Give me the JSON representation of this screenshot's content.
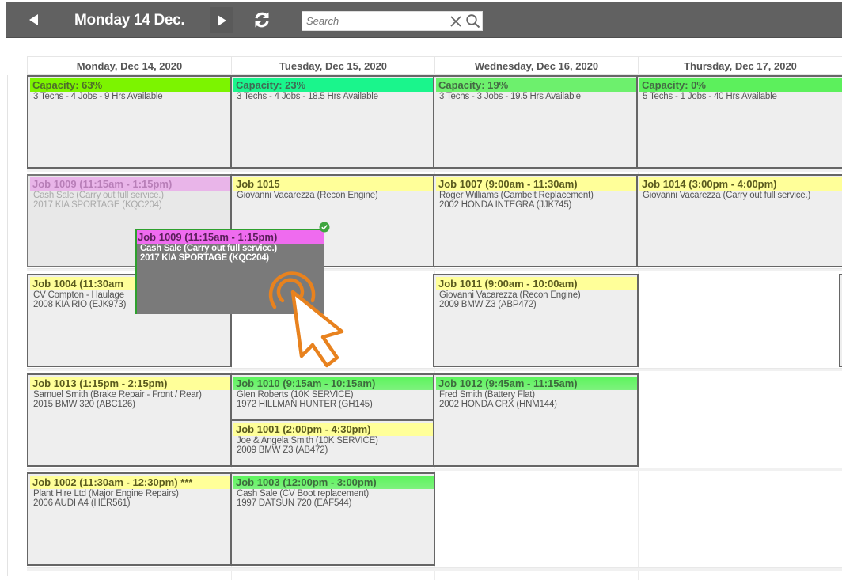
{
  "toolbar": {
    "prev_icon": "triangle-left-icon",
    "title": "Monday 14 Dec.",
    "next_icon": "triangle-right-icon",
    "refresh_icon": "refresh-icon",
    "search": {
      "placeholder": "Search",
      "value": "",
      "clear_icon": "close-icon",
      "search_icon": "search-icon"
    }
  },
  "calendar": {
    "days": [
      {
        "label": "Monday, Dec 14, 2020"
      },
      {
        "label": "Tuesday, Dec 15, 2020"
      },
      {
        "label": "Wednesday, Dec 16, 2020"
      },
      {
        "label": "Thursday, Dec 17, 2020"
      }
    ],
    "capacity": [
      {
        "title": "Capacity: 63%",
        "percent": 63,
        "summary": "3 Techs - 4 Jobs - 9 Hrs Available",
        "color": "#7cf400"
      },
      {
        "title": "Capacity: 23%",
        "percent": 23,
        "summary": "3 Techs - 4 Jobs - 18.5 Hrs Available",
        "color": "#1af58c"
      },
      {
        "title": "Capacity: 19%",
        "percent": 19,
        "summary": "3 Techs - 3 Jobs - 19.5 Hrs Available",
        "color": "#6df06d"
      },
      {
        "title": "Capacity: 0%",
        "percent": 0,
        "summary": "5 Techs - 1 Jobs - 40 Hrs Available",
        "color": "#5cf05c"
      }
    ],
    "jobs": {
      "j1009_ghost": {
        "title": "Job 1009 (11:15am - 1:15pm)",
        "line1": "Cash Sale (Carry out full service.)",
        "line2": "2017 KIA SPORTAGE (KQC204)",
        "status": "dragging-source"
      },
      "j1015": {
        "title": "Job 1015",
        "line1": "Giovanni Vacarezza (Recon Engine)",
        "line2": "",
        "color": "yellow"
      },
      "j1007": {
        "title": "Job 1007 (9:00am - 11:30am)",
        "line1": "Roger Williams (Cambelt Replacement)",
        "line2": "2002 HONDA INTEGRA (JJK745)",
        "color": "yellow"
      },
      "j1014": {
        "title": "Job 1014 (3:00pm - 4:00pm)",
        "line1": "Giovanni Vacarezza (Carry out full service.)",
        "line2": "",
        "color": "yellow"
      },
      "j1004": {
        "title": "Job 1004 (11:30am",
        "line1": "CV Compton - Haulage",
        "line2": "2008 KIA RIO (EJK973)",
        "color": "yellow"
      },
      "j1011": {
        "title": "Job 1011 (9:00am - 10:00am)",
        "line1": "Giovanni Vacarezza (Recon Engine)",
        "line2": "2009 BMW Z3 (ABP472)",
        "color": "yellow"
      },
      "j1013": {
        "title": "Job 1013 (1:15pm - 2:15pm)",
        "line1": "Samuel Smith (Brake Repair - Front / Rear)",
        "line2": "2015 BMW 320 (ABC126)",
        "color": "yellow"
      },
      "j1010": {
        "title": "Job 1010 (9:15am - 10:15am)",
        "line1": "Glen Roberts (10K SERVICE)",
        "line2": "1972 HILLMAN HUNTER (GH145)",
        "color": "green"
      },
      "j1001": {
        "title": "Job 1001 (2:00pm - 4:30pm)",
        "line1": "Joe & Angela Smith (10K SERVICE)",
        "line2": "2009 BMW Z3 (AB472)",
        "color": "yellow"
      },
      "j1012": {
        "title": "Job 1012 (9:45am - 11:15am)",
        "line1": "Fred Smith (Battery Flat)",
        "line2": "2002 HONDA CRX (HNM144)",
        "color": "green"
      },
      "j1002": {
        "title": "Job 1002 (11:30am - 12:30pm) ***",
        "line1": "Plant Hire Ltd (Major Engine Repairs)",
        "line2": "2006 AUDI A4 (HER561)",
        "color": "yellow"
      },
      "j1003": {
        "title": "Job 1003 (12:00pm - 3:00pm)",
        "line1": "Cash Sale (CV Boot replacement)",
        "line2": "1997 DATSUN 720 (EAF544)",
        "color": "green"
      }
    },
    "drag_card": {
      "title": "Job 1009 (11:15am - 1:15pm)",
      "line1": "Cash Sale (Carry out full service.)",
      "line2": "2017 KIA SPORTAGE (KQC204)",
      "badge_icon": "check-circle-icon",
      "cursor_icon": "tap-pointer-icon"
    }
  },
  "colors": {
    "toolbar_bg": "#616161",
    "job_yellow": "#ffff99",
    "job_green": "#5cf45c",
    "job_magenta": "#ef6bef",
    "cursor_orange": "#e8821e",
    "drop_ok_green": "#2ea02e"
  }
}
